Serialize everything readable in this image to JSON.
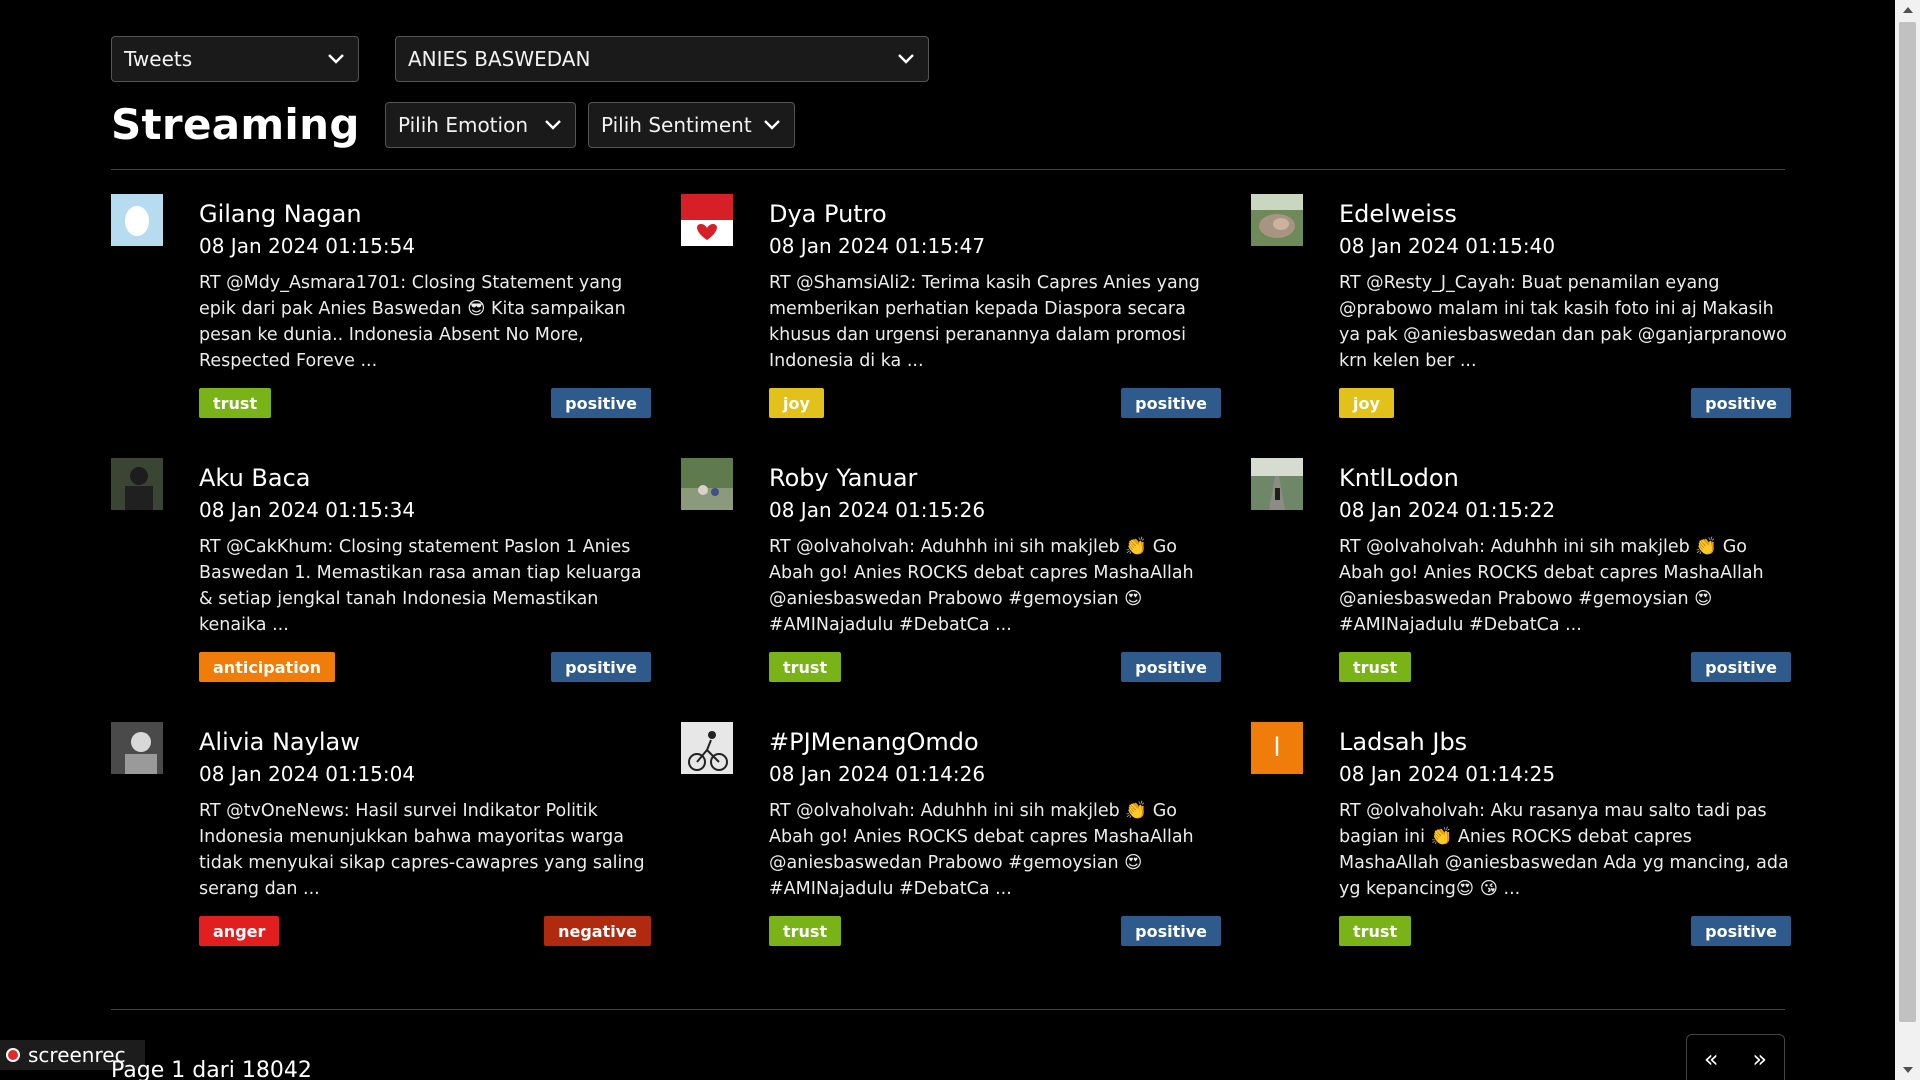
{
  "filters": {
    "type": "Tweets",
    "candidate": "ANIES BASWEDAN",
    "emotion": "Pilih Emotion",
    "sentiment": "Pilih Sentiment"
  },
  "page_title": "Streaming",
  "colors": {
    "trust": "#7ab317",
    "joy": "#e2c11a",
    "anticipation": "#f07d0a",
    "anger": "#e21f1f",
    "positive": "#2e5a8c",
    "negative": "#b02a0f"
  },
  "tweets": [
    {
      "name": "Gilang Nagan",
      "time": "08 Jan 2024 01:15:54",
      "text": "RT @Mdy_Asmara1701: Closing Statement yang epik dari pak Anies Baswedan 😎 Kita sampaikan pesan ke dunia.. Indonesia Absent No More, Respected Foreve ...",
      "emotion": "trust",
      "sentiment": "positive",
      "avatar": "egg"
    },
    {
      "name": "Dya Putro",
      "time": "08 Jan 2024 01:15:47",
      "text": "RT @ShamsiAli2: Terima kasih Capres Anies yang memberikan perhatian kepada Diaspora secara khusus dan urgensi peranannya dalam promosi Indonesia di ka ...",
      "emotion": "joy",
      "sentiment": "positive",
      "avatar": "flag"
    },
    {
      "name": "Edelweiss",
      "time": "08 Jan 2024 01:15:40",
      "text": "RT @Resty_J_Cayah: Buat penamilan eyang @prabowo malam ini tak kasih foto ini aj Makasih ya pak @aniesbaswedan dan pak @ganjarpranowo krn kelen ber ...",
      "emotion": "joy",
      "sentiment": "positive",
      "avatar": "nature"
    },
    {
      "name": "Aku Baca",
      "time": "08 Jan 2024 01:15:34",
      "text": "RT @CakKhum: Closing statement Paslon 1 Anies Baswedan 1. Memastikan rasa aman tiap keluarga & setiap jengkal tanah Indonesia Memastikan kenaika ...",
      "emotion": "anticipation",
      "sentiment": "positive",
      "avatar": "person-dark"
    },
    {
      "name": "Roby Yanuar",
      "time": "08 Jan 2024 01:15:26",
      "text": "RT @olvaholvah: Aduhhh ini sih makjleb 👏 Go Abah go! Anies ROCKS debat capres MashaAllah @aniesbaswedan Prabowo #gemoysian 😍 #AMINajadulu #DebatCa ...",
      "emotion": "trust",
      "sentiment": "positive",
      "avatar": "outdoor"
    },
    {
      "name": "KntlLodon",
      "time": "08 Jan 2024 01:15:22",
      "text": "RT @olvaholvah: Aduhhh ini sih makjleb 👏 Go Abah go! Anies ROCKS debat capres MashaAllah @aniesbaswedan Prabowo #gemoysian 😍 #AMINajadulu #DebatCa ...",
      "emotion": "trust",
      "sentiment": "positive",
      "avatar": "road"
    },
    {
      "name": "Alivia Naylaw",
      "time": "08 Jan 2024 01:15:04",
      "text": "RT @tvOneNews: Hasil survei Indikator Politik Indonesia menunjukkan bahwa mayoritas warga tidak menyukai sikap capres-cawapres yang saling serang dan ...",
      "emotion": "anger",
      "sentiment": "negative",
      "avatar": "girl"
    },
    {
      "name": "#PJMenangOmdo",
      "time": "08 Jan 2024 01:14:26",
      "text": "RT @olvaholvah: Aduhhh ini sih makjleb 👏 Go Abah go! Anies ROCKS debat capres MashaAllah @aniesbaswedan Prabowo #gemoysian 😍 #AMINajadulu #DebatCa ...",
      "emotion": "trust",
      "sentiment": "positive",
      "avatar": "cyclist"
    },
    {
      "name": "Ladsah Jbs",
      "time": "08 Jan 2024 01:14:25",
      "text": "RT @olvaholvah: Aku rasanya mau salto tadi pas bagian ini 👏 Anies ROCKS debat capres MashaAllah @aniesbaswedan Ada yg mancing, ada yg kepancing😍 😘 ...",
      "emotion": "trust",
      "sentiment": "positive",
      "avatar": "letter",
      "avatar_letter": "l"
    }
  ],
  "pagination": {
    "info": "Page 1 dari 18042",
    "prev": "«",
    "next": "»"
  },
  "recorder": {
    "label": "screenrec"
  }
}
